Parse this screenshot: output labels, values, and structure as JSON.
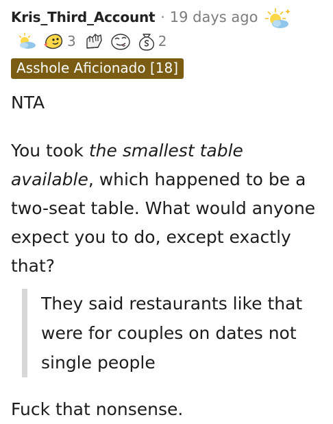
{
  "comment": {
    "author": "Kris_Third_Account",
    "separator": "·",
    "timestamp": "19 days ago",
    "header_award_icon": "sun-cloud-award-icon",
    "awards": [
      {
        "icon": "sun-cloud-award-icon",
        "count": ""
      },
      {
        "icon": "wholesome-seal-award-icon",
        "count": "3"
      },
      {
        "icon": "hand-award-icon",
        "count": ""
      },
      {
        "icon": "cheeky-face-award-icon",
        "count": ""
      },
      {
        "icon": "money-bag-award-icon",
        "count": "2"
      }
    ],
    "flair": "Asshole Aficionado [18]",
    "flair_color": "#7a5c12",
    "body": {
      "p1": "NTA",
      "p2_before": "You took ",
      "p2_emphasis": "the smallest table available",
      "p2_after": ", which happened to be a two-seat table. What would anyone expect you to do, except exactly that?",
      "quote": "They said restaurants like that were for couples on dates not single people",
      "p3": "Fuck that nonsense."
    }
  }
}
